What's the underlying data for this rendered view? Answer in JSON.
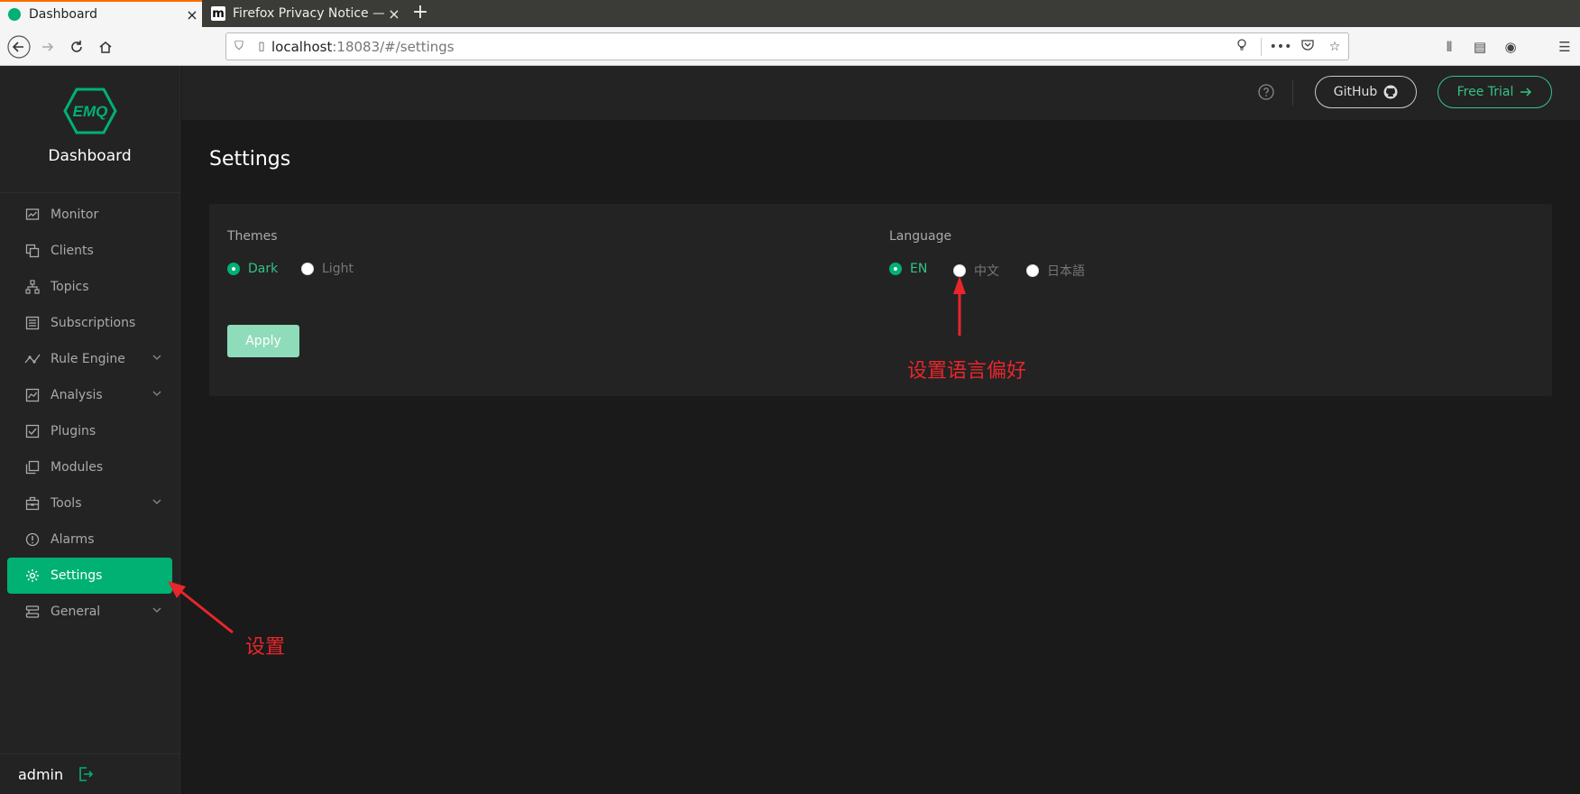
{
  "browser": {
    "tabs": [
      {
        "title": "Dashboard",
        "close": "×"
      },
      {
        "title": "Firefox Privacy Notice —",
        "favicon": "m"
      }
    ],
    "newtab": "+",
    "url_host": "localhost",
    "url_path": ":18083/#/settings"
  },
  "sidebar": {
    "logo": "EMQ",
    "title": "Dashboard",
    "items": [
      {
        "label": "Monitor"
      },
      {
        "label": "Clients"
      },
      {
        "label": "Topics"
      },
      {
        "label": "Subscriptions"
      },
      {
        "label": "Rule Engine"
      },
      {
        "label": "Analysis"
      },
      {
        "label": "Plugins"
      },
      {
        "label": "Modules"
      },
      {
        "label": "Tools"
      },
      {
        "label": "Alarms"
      },
      {
        "label": "Settings"
      },
      {
        "label": "General"
      }
    ],
    "user": "admin"
  },
  "header": {
    "github": "GitHub",
    "trial": "Free Trial"
  },
  "page": {
    "title": "Settings",
    "themes_label": "Themes",
    "themes": [
      {
        "label": "Dark",
        "checked": true
      },
      {
        "label": "Light",
        "checked": false
      }
    ],
    "language_label": "Language",
    "languages": [
      {
        "label": "EN",
        "checked": true
      },
      {
        "label": "中文",
        "checked": false
      },
      {
        "label": "日本語",
        "checked": false
      }
    ],
    "apply": "Apply"
  },
  "annotations": {
    "language": "设置语言偏好",
    "settings": "设置"
  },
  "colors": {
    "accent": "#00b173",
    "annotation": "#e8262b"
  }
}
